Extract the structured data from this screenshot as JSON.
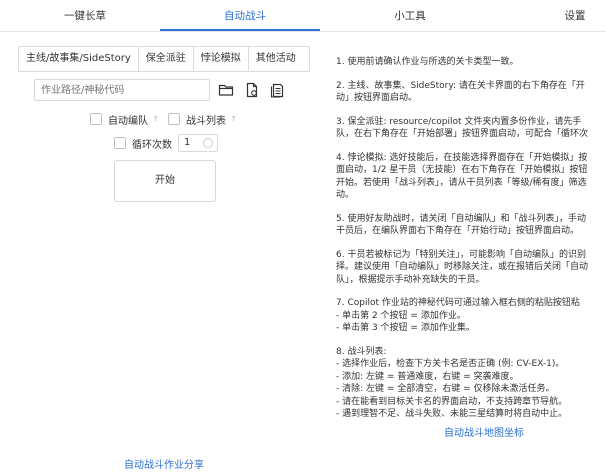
{
  "nav": {
    "tabs": [
      "一键长草",
      "自动战斗",
      "小工具",
      "设置"
    ],
    "active_index": 1,
    "accent": "#2d6fd6"
  },
  "left": {
    "subtabs": [
      "主线/故事集/SideStory",
      "保全派驻",
      "悖论模拟",
      "其他活动"
    ],
    "active_subtab": 0,
    "path_placeholder": "作业路径/神秘代码",
    "icons": [
      "folder-icon",
      "file-paste-icon",
      "file-list-icon"
    ],
    "auto_squad_label": "自动编队",
    "battle_list_label": "战斗列表",
    "help_mark": "?",
    "loop_label": "循环次数",
    "loop_value": "1",
    "start_button": "开始",
    "link_share": "自动战斗作业分享",
    "link_map": "自动战斗地图坐标"
  },
  "help": {
    "p1": [
      "1. 使用前请确认作业与所选的关卡类型一致。"
    ],
    "p2": [
      "2. 主线、故事集、SideStory: 请在关卡界面的右下角存在「开",
      "动」按钮界面启动。"
    ],
    "p3": [
      "3. 保全派驻: resource/copilot 文件夹内置多份作业，请先手",
      "队，在右下角存在「开始部署」按钮界面启动，可配合「循环次"
    ],
    "p4": [
      "4. 悖论模拟: 选好技能后，在技能选择界面存在「开始模拟」按",
      "面启动，1/2 星干员（无技能）在右下角存在「开始模拟」按钮",
      "开始。若使用「战斗列表」，请从干员列表「等级/稀有度」筛选",
      "动。"
    ],
    "p5": [
      "5. 使用好友助战时，请关闭「自动编队」和「战斗列表」，手动",
      "干员后，在编队界面右下角存在「开始行动」按钮界面启动。"
    ],
    "p6": [
      "6. 干员若被标记为「特别关注」，可能影响「自动编队」的识别",
      "择。建议使用「自动编队」时移除关注，或在报错后关闭「自动",
      "队」，根据提示手动补充缺失的干员。"
    ],
    "p7": [
      "7. Copilot 作业站的神秘代码可通过输入框右侧的粘贴按钮粘",
      "- 单击第 2 个按钮 = 添加作业。",
      "- 单击第 3 个按钮 = 添加作业集。"
    ],
    "p8": [
      "8. 战斗列表:",
      "- 选择作业后，检查下方关卡名是否正确 (例: CV-EX-1)。",
      "- 添加: 左键 = 普通难度，右键 = 突袭难度。",
      "- 清除: 左键 = 全部清空，右键 = 仅移除未激活任务。",
      "- 请在能看到目标关卡名的界面启动，不支持跨章节导航。",
      "- 遇到理智不足、战斗失败、未能三星结算时将自动中止。"
    ]
  }
}
